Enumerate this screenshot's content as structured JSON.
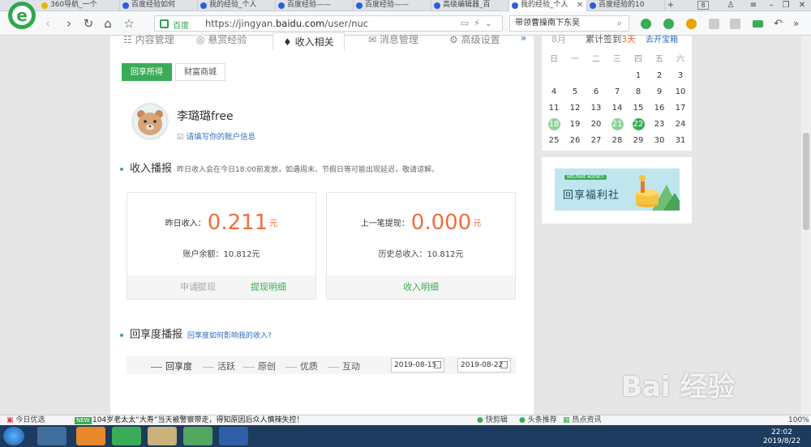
{
  "browser": {
    "tabs": [
      {
        "label": "360导航_一个",
        "active": false
      },
      {
        "label": "百度经验如何",
        "active": false
      },
      {
        "label": "我的经验_个人",
        "active": false
      },
      {
        "label": "百度经验——",
        "active": false
      },
      {
        "label": "百度经验——",
        "active": false
      },
      {
        "label": "高级编辑器_百",
        "active": false
      },
      {
        "label": "我的经验_个人",
        "active": true
      },
      {
        "label": "百度经验的10",
        "active": false
      }
    ],
    "tab_count": "8",
    "url_site": "百度",
    "url_prefix": "https://jingyan.",
    "url_domain": "baidu.com",
    "url_path": "/user/nuc",
    "search_text": "带领曹操南下东吴"
  },
  "subnav": {
    "items": [
      "内容管理",
      "悬赏经验",
      "收入相关",
      "消息管理",
      "高级设置"
    ],
    "more": "»"
  },
  "income_tabs": [
    "回享所得",
    "财富商城"
  ],
  "user": {
    "name": "李璐璐free",
    "edit_link": "请填写你的账户信息"
  },
  "income_report": {
    "title": "收入播报",
    "note": "昨日收入会在今日18:00前发放，如遇周末、节假日等可能出现延迟，敬请谅解。"
  },
  "card_left": {
    "label": "昨日收入：",
    "amount": "0.211",
    "unit": "元",
    "sub": "账户余额：10.812元",
    "action_disabled": "申请提现",
    "action_link": "提现明细"
  },
  "card_right": {
    "label": "上一笔提现：",
    "amount": "0.000",
    "unit": "元",
    "sub": "历史总收入：10.812元",
    "action_link": "收入明细"
  },
  "degree_report": {
    "title": "回享度播报",
    "link": "回享度如何影响我的收入?"
  },
  "filter": {
    "items": [
      "回享度",
      "活跃",
      "原创",
      "优质",
      "互动"
    ],
    "date_from": "2019-08-15",
    "date_sep": "到",
    "date_to": "2019-08-22"
  },
  "calendar": {
    "month": "8月",
    "streak_prefix": "累计签到",
    "streak_days": "3天",
    "treasure_link": "去开宝箱",
    "weekdays": [
      "日",
      "一",
      "二",
      "三",
      "四",
      "五",
      "六"
    ],
    "weeks": [
      [
        "",
        "",
        "",
        "",
        "1",
        "2",
        "3"
      ],
      [
        "4",
        "5",
        "6",
        "7",
        "8",
        "9",
        "10"
      ],
      [
        "11",
        "12",
        "13",
        "14",
        "15",
        "16",
        "17"
      ],
      [
        "18",
        "19",
        "20",
        "21",
        "22",
        "23",
        "24"
      ],
      [
        "25",
        "26",
        "27",
        "28",
        "29",
        "30",
        "31"
      ]
    ],
    "signed_days": [
      "18",
      "21"
    ],
    "today": "22"
  },
  "banner": {
    "tag": "WELFARE AGENCY",
    "title": "回享福利社"
  },
  "watermark": "Bai 经验",
  "statusbar": {
    "left": "今日优选",
    "badge": "NEW",
    "news": "104岁老太太“大寿”当天被警察带走，得知原因后众人慎辣失控！",
    "r1": "快剪辑",
    "r2": "头条推荐",
    "r3": "热点资讯",
    "zoom": "100%"
  },
  "clock": {
    "time": "22:02",
    "date": "2019/8/22"
  }
}
